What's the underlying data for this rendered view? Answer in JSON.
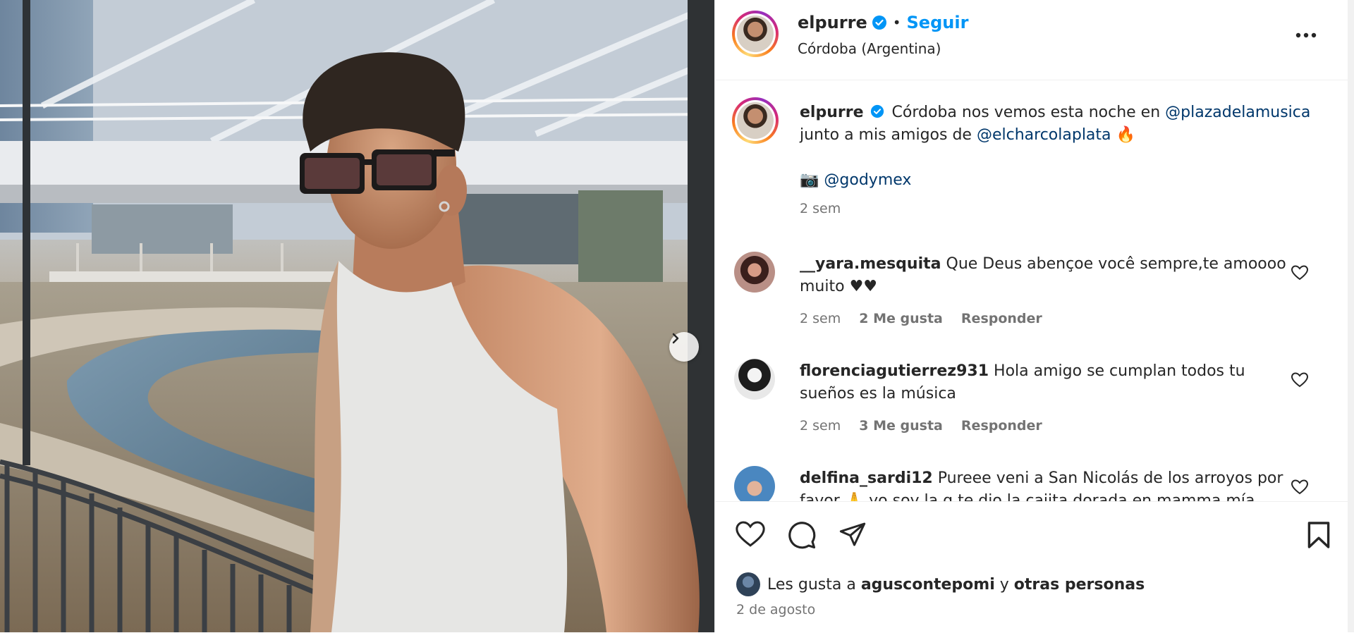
{
  "post": {
    "username": "elpurre",
    "follow_label": "Seguir",
    "separator": "•",
    "location": "Córdoba (Argentina)"
  },
  "caption": {
    "username": "elpurre",
    "text_1": "Córdoba nos vemos esta noche en",
    "mention_1": "@plazadelamusica",
    "text_2": "junto a mis amigos de",
    "mention_2": "@elcharcolaplata",
    "emoji_fire": "🔥",
    "camera_emoji": "📷",
    "mention_3": "@godymex",
    "time": "2 sem"
  },
  "comments": [
    {
      "username": "__yara.mesquita",
      "text": "Que Deus abençoe você sempre,te amoooo muito ♥♥",
      "time": "2 sem",
      "likes": "2 Me gusta",
      "reply": "Responder"
    },
    {
      "username": "florenciagutierrez931",
      "text": "Hola amigo se cumplan todos tu sueños es la música",
      "time": "2 sem",
      "likes": "3 Me gusta",
      "reply": "Responder"
    },
    {
      "username": "delfina_sardi12",
      "text": "Pureee veni a San Nicolás de los arroyos por favor 🙏 yo soy la q te dio la cajita dorada en mamma mía"
    }
  ],
  "footer": {
    "likes_prefix": "Les gusta a",
    "likes_user": "aguscontepomi",
    "likes_join": "y",
    "likes_others": "otras personas",
    "date": "2 de agosto"
  },
  "icons": {
    "verified": "verified-badge-icon",
    "more": "more-options-icon",
    "next": "chevron-right-icon",
    "like": "heart-icon",
    "comment": "comment-icon",
    "share": "paper-plane-icon",
    "save": "bookmark-icon"
  },
  "colors": {
    "follow_blue": "#0095f6",
    "mention_blue": "#00376b",
    "verified_blue": "#0095f6",
    "meta_gray": "#737373"
  }
}
